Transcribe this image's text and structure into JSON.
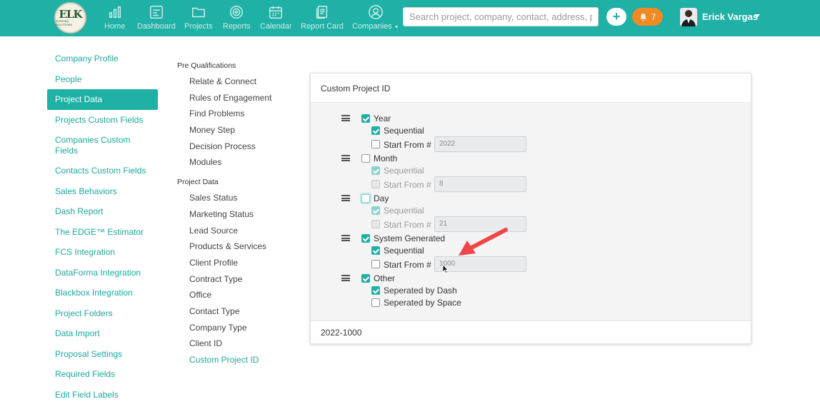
{
  "brand": {
    "logo_text": "ELK",
    "logo_subtext": "ROOFING SOLUTIONS"
  },
  "nav": {
    "items": [
      {
        "label": "Home",
        "icon": "bar-chart-icon"
      },
      {
        "label": "Dashboard",
        "icon": "dashboard-icon"
      },
      {
        "label": "Projects",
        "icon": "folder-icon"
      },
      {
        "label": "Reports",
        "icon": "target-icon"
      },
      {
        "label": "Calendar",
        "icon": "calendar-icon"
      },
      {
        "label": "Report Card",
        "icon": "report-card-icon"
      },
      {
        "label": "Companies",
        "icon": "user-circle-icon"
      }
    ],
    "search_placeholder": "Search project, company, contact, address, phc",
    "add_button": "+",
    "notification_count": "7",
    "user_name": "Erick Vargas"
  },
  "sidebar": {
    "items": [
      "Company Profile",
      "People",
      "Project Data",
      "Projects Custom Fields",
      "Companies Custom Fields",
      "Contacts Custom Fields",
      "Sales Behaviors",
      "Dash Report",
      "The EDGE™ Estimator",
      "FCS Integration",
      "DataForma Integration",
      "Blackbox Integration",
      "Project Folders",
      "Data Import",
      "Proposal Settings",
      "Required Fields",
      "Edit Field Labels"
    ],
    "active": "Project Data"
  },
  "submenu": {
    "pre_heading": "Pre Qualifications",
    "pre_items": [
      "Relate & Connect",
      "Rules of Engagement",
      "Find Problems",
      "Money Step",
      "Decision Process",
      "Modules"
    ],
    "data_heading": "Project Data",
    "data_items": [
      "Sales Status",
      "Marketing Status",
      "Lead Source",
      "Products & Services",
      "Client Profile",
      "Contract Type",
      "Office",
      "Contact Type",
      "Company Type",
      "Client ID",
      "Custom Project ID"
    ],
    "active": "Custom Project ID"
  },
  "card": {
    "title": "Custom Project ID",
    "groups": {
      "year": {
        "label": "Year",
        "checked": true,
        "sequential_label": "Sequential",
        "sequential_checked": true,
        "start_from_label": "Start From #",
        "start_from_checked": false,
        "start_value": "2022"
      },
      "month": {
        "label": "Month",
        "checked": false,
        "sequential_label": "Sequential",
        "sequential_checked": true,
        "start_from_label": "Start From #",
        "start_from_checked": false,
        "start_value": "8"
      },
      "day": {
        "label": "Day",
        "checked": false,
        "sequential_label": "Sequential",
        "sequential_checked": true,
        "start_from_label": "Start From #",
        "start_from_checked": false,
        "start_value": "21"
      },
      "system": {
        "label": "System Generated",
        "checked": true,
        "sequential_label": "Sequential",
        "sequential_checked": true,
        "start_from_label": "Start From #",
        "start_from_checked": false,
        "start_value": "1000"
      },
      "other": {
        "label": "Other",
        "checked": true,
        "dash_label": "Seperated by Dash",
        "dash_checked": true,
        "space_label": "Seperated by Space",
        "space_checked": false
      }
    },
    "preview": "2022-1000"
  },
  "colors": {
    "accent": "#1fb0a6",
    "notification": "#f08a24",
    "annotation_arrow": "#f0464a"
  }
}
